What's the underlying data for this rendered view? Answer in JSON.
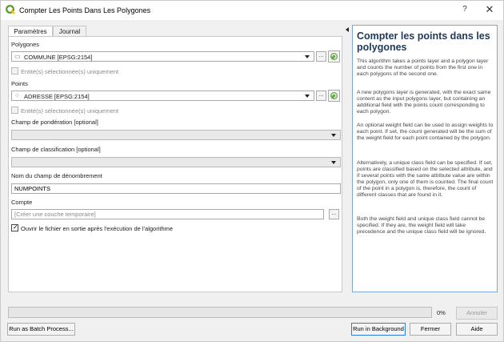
{
  "window": {
    "title": "Compter Les Points Dans Les Polygones",
    "help_button": "?",
    "close_button": "✕"
  },
  "tabs": [
    "Paramètres",
    "Journal"
  ],
  "params": {
    "polygones": {
      "label": "Polygones",
      "value": "COMMUNE [EPSG:2154]",
      "selected_only": "Entité(s) sélectionnée(s) uniquement"
    },
    "points": {
      "label": "Points",
      "value": "ADRESSE [EPSG:2154]",
      "selected_only": "Entité(s) sélectionnée(s) uniquement"
    },
    "weight_field": {
      "label": "Champ de pondération [optional]",
      "value": ""
    },
    "class_field": {
      "label": "Champ de classification [optional]",
      "value": ""
    },
    "count_field": {
      "label": "Nom du champ de dénombrement",
      "value": "NUMPOINTS"
    },
    "output": {
      "label": "Compte",
      "placeholder": "[Créer une couche temporaire]"
    },
    "open_output": {
      "label": "Ouvrir le fichier en sortie après l'exécution de l'algorithme",
      "checked": true
    }
  },
  "help": {
    "title": "Compter les points dans les polygones",
    "paragraphs": [
      "This algorithm takes a points layer and a polygon layer and counts the number of points from the first one in each polygons of the second one.",
      "A new polygons layer is generated, with the exact same content as the input polygons layer, but containing an additional field with the points count corresponding to each polygon.",
      "An optional weight field can be used to assign weights to each point. If set, the count generated will be the sum of the weight field for each point contained by the polygon.",
      "Alternatively, a unique class field can be specified. If set, points are classified based on the selected attribute, and if several points with the same attribute value are within the polygon, only one of them is counted. The final count of the point in a polygon is, therefore, the count of different classes that are found in it.",
      "Both the weight field and unique class field cannot be specified. If they are, the weight field will take precedence and the unique class field will be ignored."
    ]
  },
  "progress": {
    "percent": 0,
    "label": "0%"
  },
  "buttons": {
    "cancel": "Annuler",
    "batch": "Run as Batch Process...",
    "background": "Run in Background",
    "close": "Fermer",
    "help": "Aide"
  },
  "colors": {
    "accent": "#3daee9",
    "help_title": "#203a5a",
    "qgis_green": "#589632",
    "qgis_yellow": "#eec900"
  }
}
